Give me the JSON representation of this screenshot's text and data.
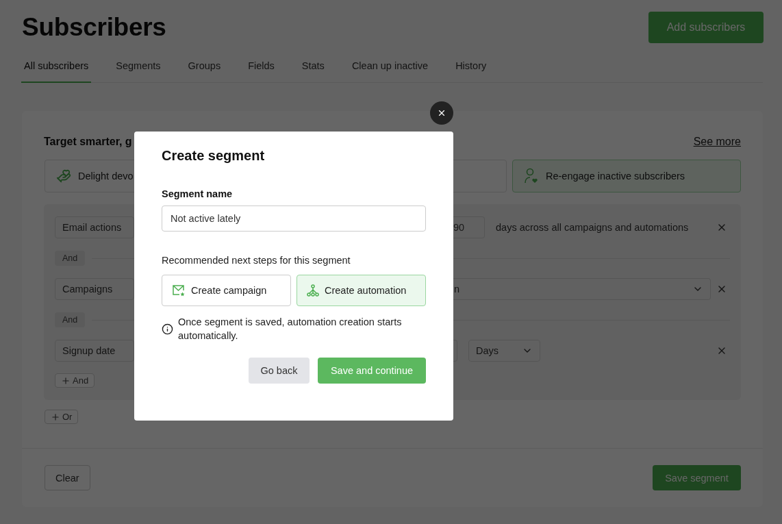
{
  "page": {
    "title": "Subscribers",
    "primary_action": "Add subscribers"
  },
  "tabs": [
    {
      "label": "All subscribers",
      "selected": true
    },
    {
      "label": "Segments",
      "selected": false
    },
    {
      "label": "Groups",
      "selected": false
    },
    {
      "label": "Fields",
      "selected": false
    },
    {
      "label": "Stats",
      "selected": false
    },
    {
      "label": "Clean up inactive",
      "selected": false
    },
    {
      "label": "History",
      "selected": false
    }
  ],
  "segment_builder": {
    "intro": "Target smarter, g",
    "see_more": "See more",
    "presets": [
      {
        "kind": "delight",
        "label": "Delight devo",
        "selected": false
      },
      {
        "kind": "hidden",
        "selected": false
      },
      {
        "kind": "reengage",
        "label": "Re-engage inactive subscribers",
        "selected": true
      }
    ],
    "rules": [
      {
        "kind": "number",
        "field": "Email actions",
        "value": "90",
        "suffix": "days across all campaigns and automations"
      },
      {
        "kind": "select",
        "joiner": "And",
        "field": "Campaigns",
        "value": "n"
      },
      {
        "kind": "unit",
        "joiner": "And",
        "field": "Signup date",
        "unit": "Days"
      }
    ],
    "add_and": "And",
    "add_or": "Or",
    "clear": "Clear",
    "save": "Save segment"
  },
  "modal": {
    "title": "Create segment",
    "name_label": "Segment name",
    "name_value": "Not active lately",
    "steps_label": "Recommended next steps for this segment",
    "steps": [
      {
        "kind": "campaign",
        "label": "Create campaign",
        "selected": false
      },
      {
        "kind": "automation",
        "label": "Create automation",
        "selected": true
      }
    ],
    "note": "Once segment is saved, automation creation starts automatically.",
    "back": "Go back",
    "confirm": "Save and continue"
  }
}
